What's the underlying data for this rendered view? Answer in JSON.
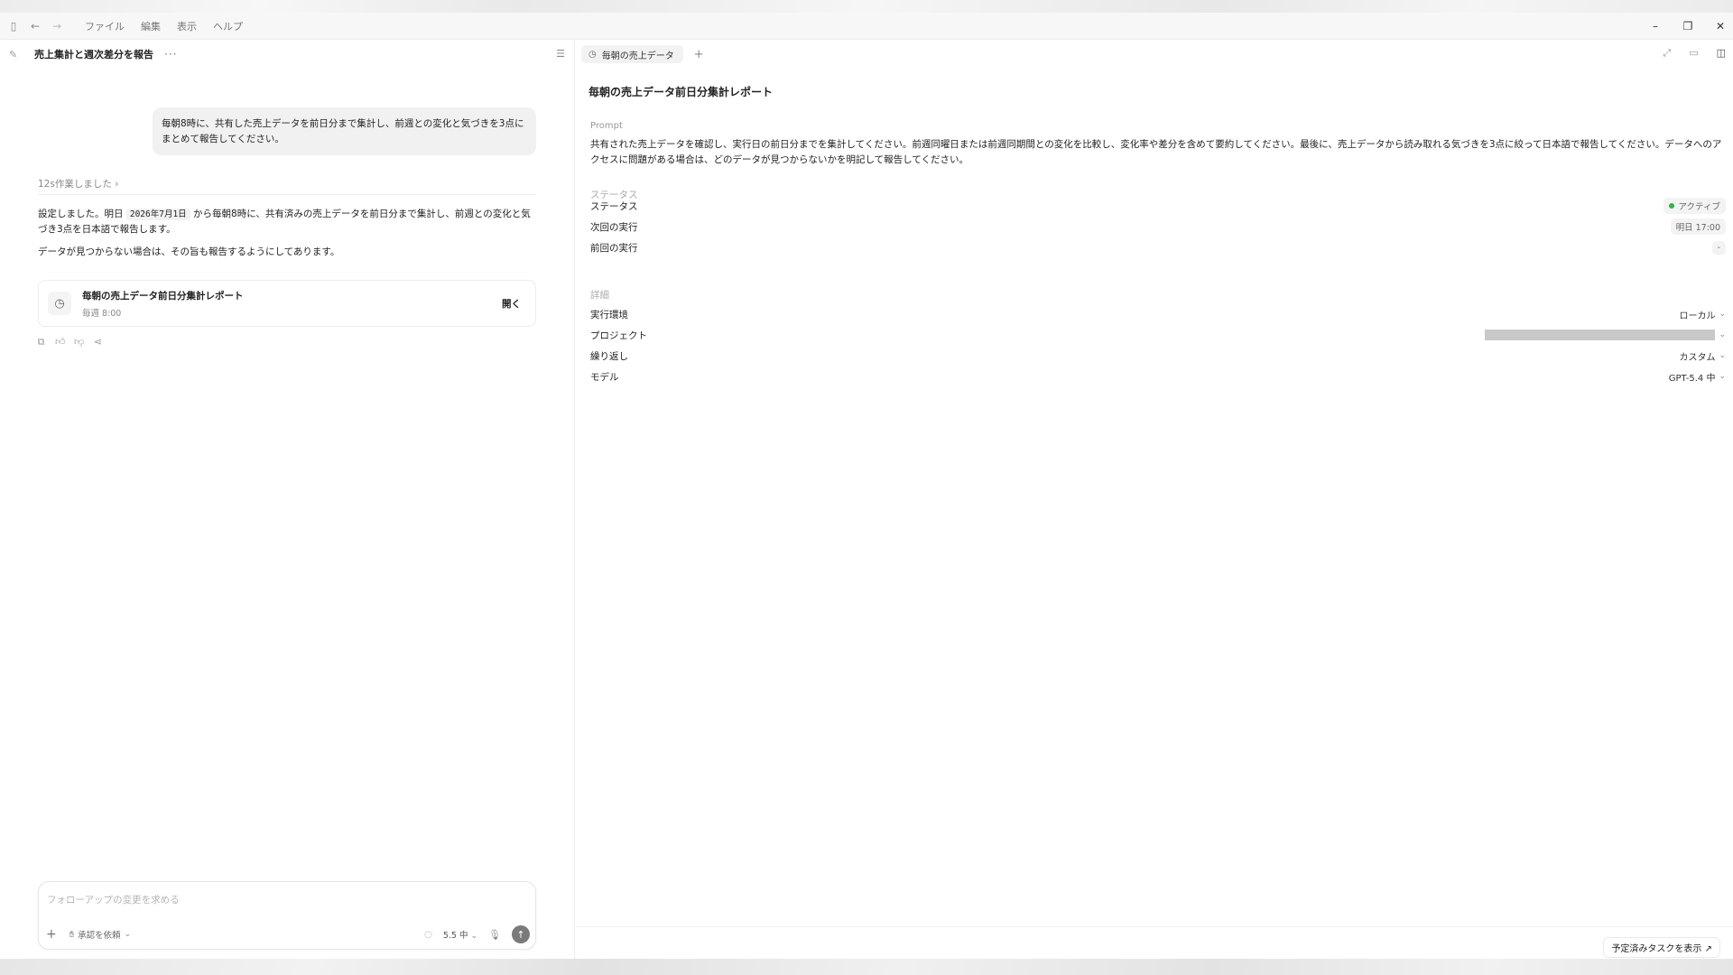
{
  "menubar": {
    "items": [
      "ファイル",
      "編集",
      "表示",
      "ヘルプ"
    ]
  },
  "left": {
    "conversation_title": "売上集計と週次差分を報告",
    "user_message": "毎朝8時に、共有した売上データを前日分まで集計し、前週との変化と気づきを3点にまとめて報告してください。",
    "worked_label": "12s作業しました",
    "reply": {
      "part1": "設定しました。明日",
      "date_code": "2026年7月1日",
      "part2": "から毎朝8時に、共有済みの売上データを前日分まで集計し、前週との変化と気づき3点を日本語で報告します。",
      "line2": "データが見つからない場合は、その旨も報告するようにしてあります。"
    },
    "task_card": {
      "title": "毎朝の売上データ前日分集計レポート",
      "subtitle": "毎週 8:00",
      "open_label": "開く"
    },
    "composer": {
      "placeholder": "フォローアップの変更を求める",
      "approval_label": "承認を依頼",
      "model_label": "5.5 中"
    }
  },
  "right": {
    "tab_label": "毎朝の売上データ",
    "title": "毎朝の売上データ前日分集計レポート",
    "prompt_label": "Prompt",
    "prompt_text": "共有された売上データを確認し、実行日の前日分までを集計してください。前週同曜日または前週同期間との変化を比較し、変化率や差分を含めて要約してください。最後に、売上データから読み取れる気づきを3点に絞って日本語で報告してください。データへのアクセスに問題がある場合は、どのデータが見つからないかを明記して報告してください。",
    "status_section": "ステータス",
    "status_rows": [
      {
        "label": "ステータス",
        "value": "アクティブ"
      },
      {
        "label": "次回の実行",
        "value": "明日 17:00"
      },
      {
        "label": "前回の実行",
        "value": "-"
      }
    ],
    "details_section": "詳細",
    "detail_rows": [
      {
        "label": "実行環境",
        "value": "ローカル"
      },
      {
        "label": "プロジェクト",
        "value": ""
      },
      {
        "label": "繰り返し",
        "value": "カスタム"
      },
      {
        "label": "モデル",
        "value": "GPT-5.4 中"
      }
    ],
    "scheduled_tasks_label": "予定済みタスクを表示 ↗"
  },
  "colors": {
    "status_active": "#2fb34a",
    "send_button": "#7a7a7a"
  }
}
